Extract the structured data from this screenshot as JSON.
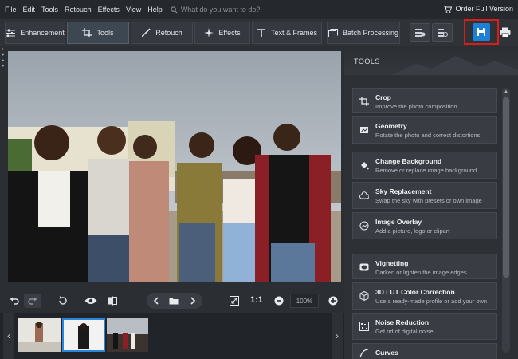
{
  "menu": {
    "items": [
      "File",
      "Edit",
      "Tools",
      "Retouch",
      "Effects",
      "View",
      "Help"
    ],
    "search_placeholder": "What do you want to do?",
    "order_label": "Order Full Version"
  },
  "toolbar": {
    "tabs": [
      {
        "label": "Enhancement",
        "icon": "sliders-icon"
      },
      {
        "label": "Tools",
        "icon": "crop-icon",
        "active": true
      },
      {
        "label": "Retouch",
        "icon": "brush-icon"
      },
      {
        "label": "Effects",
        "icon": "sparkle-icon"
      },
      {
        "label": "Text & Frames",
        "icon": "text-icon"
      },
      {
        "label": "Batch Processing",
        "icon": "images-icon"
      }
    ],
    "accent": "#1e7fd6",
    "highlight": "#d91c1c"
  },
  "controls": {
    "ratio": "1:1",
    "zoom": "100%"
  },
  "panel": {
    "title": "TOOLS",
    "tools": [
      {
        "title": "Crop",
        "desc": "Improve the photo composition",
        "icon": "crop-icon"
      },
      {
        "title": "Geometry",
        "desc": "Rotate the photo and correct distortions",
        "icon": "geometry-icon"
      },
      {
        "title": "Change Background",
        "desc": "Remove or replace image background",
        "icon": "paint-bucket-icon"
      },
      {
        "title": "Sky Replacement",
        "desc": "Swap the sky with presets or own image",
        "icon": "cloud-icon"
      },
      {
        "title": "Image Overlay",
        "desc": "Add a picture, logo or clipart",
        "icon": "overlay-icon"
      },
      {
        "title": "Vignetting",
        "desc": "Darken or lighten the image edges",
        "icon": "vignette-icon"
      },
      {
        "title": "3D LUT Color Correction",
        "desc": "Use a ready-made profile or add your own",
        "icon": "cube-icon"
      },
      {
        "title": "Noise Reduction",
        "desc": "Get rid of digital noise",
        "icon": "noise-icon"
      },
      {
        "title": "Curves",
        "desc": "",
        "icon": "curves-icon"
      }
    ]
  }
}
